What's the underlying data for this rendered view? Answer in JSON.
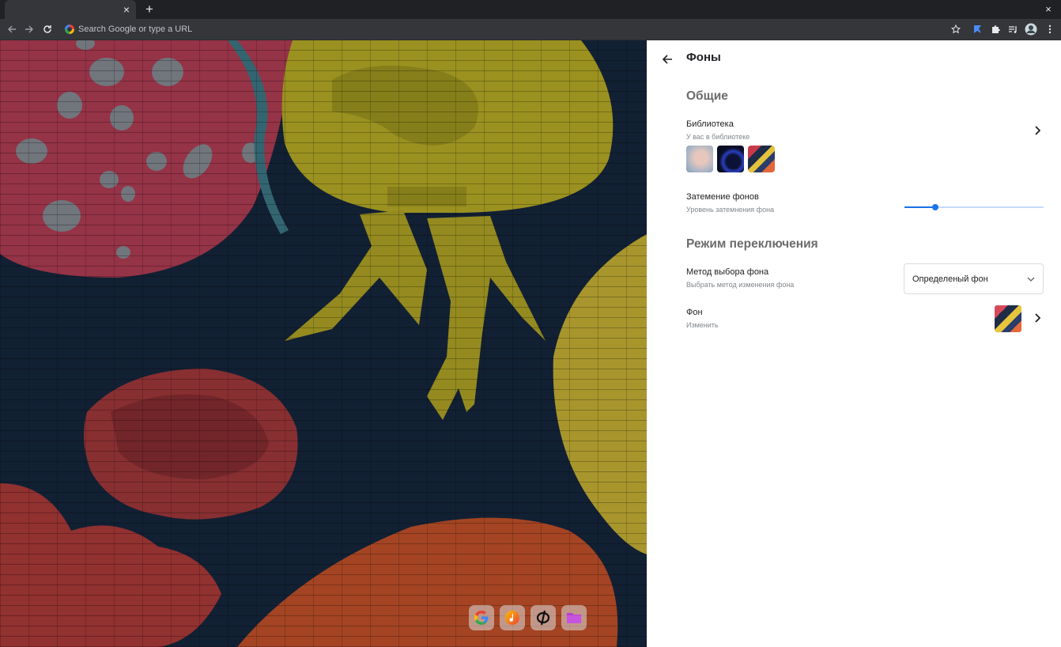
{
  "browser": {
    "omnibox_placeholder": "Search Google or type a URL",
    "tab_close_glyph": "×",
    "new_tab_glyph": "+",
    "window_close_glyph": "×",
    "extension_icons": [
      "star-icon",
      "bookmark-flag-icon",
      "puzzle-icon",
      "media-queue-icon",
      "profile-avatar-icon",
      "more-vert-icon"
    ]
  },
  "settings": {
    "title": "Фоны",
    "sections": {
      "general": "Общие",
      "switch_mode": "Режим переключения"
    },
    "library": {
      "title": "Библиотека",
      "subtitle": "У вас в библиотеке",
      "thumbnails": [
        "soft-pastel-wallpaper",
        "dark-blue-ring-wallpaper",
        "jellyfish-mural-wallpaper"
      ]
    },
    "dimming": {
      "title": "Затемение фонов",
      "subtitle": "Уровень затемнения фона",
      "level": 0.22
    },
    "method": {
      "title": "Метод выбора фона",
      "subtitle": "Выбрать метод изменения фона",
      "selected": "Определеный фон"
    },
    "background": {
      "title": "Фон",
      "subtitle": "Изменить"
    }
  },
  "dock": {
    "apps": [
      "google-app-icon",
      "music-app-icon",
      "phi-app-icon",
      "folder-app-icon"
    ]
  },
  "colors": {
    "accent": "#1a73e8",
    "panel_bg": "#ffffff",
    "chrome_bg": "#35363a",
    "section_heading": "#6b6b6b",
    "mural_pink": "#c6435a",
    "mural_yellow": "#c7bb2a",
    "mural_navy": "#16283f",
    "mural_orange": "#d2542c"
  }
}
